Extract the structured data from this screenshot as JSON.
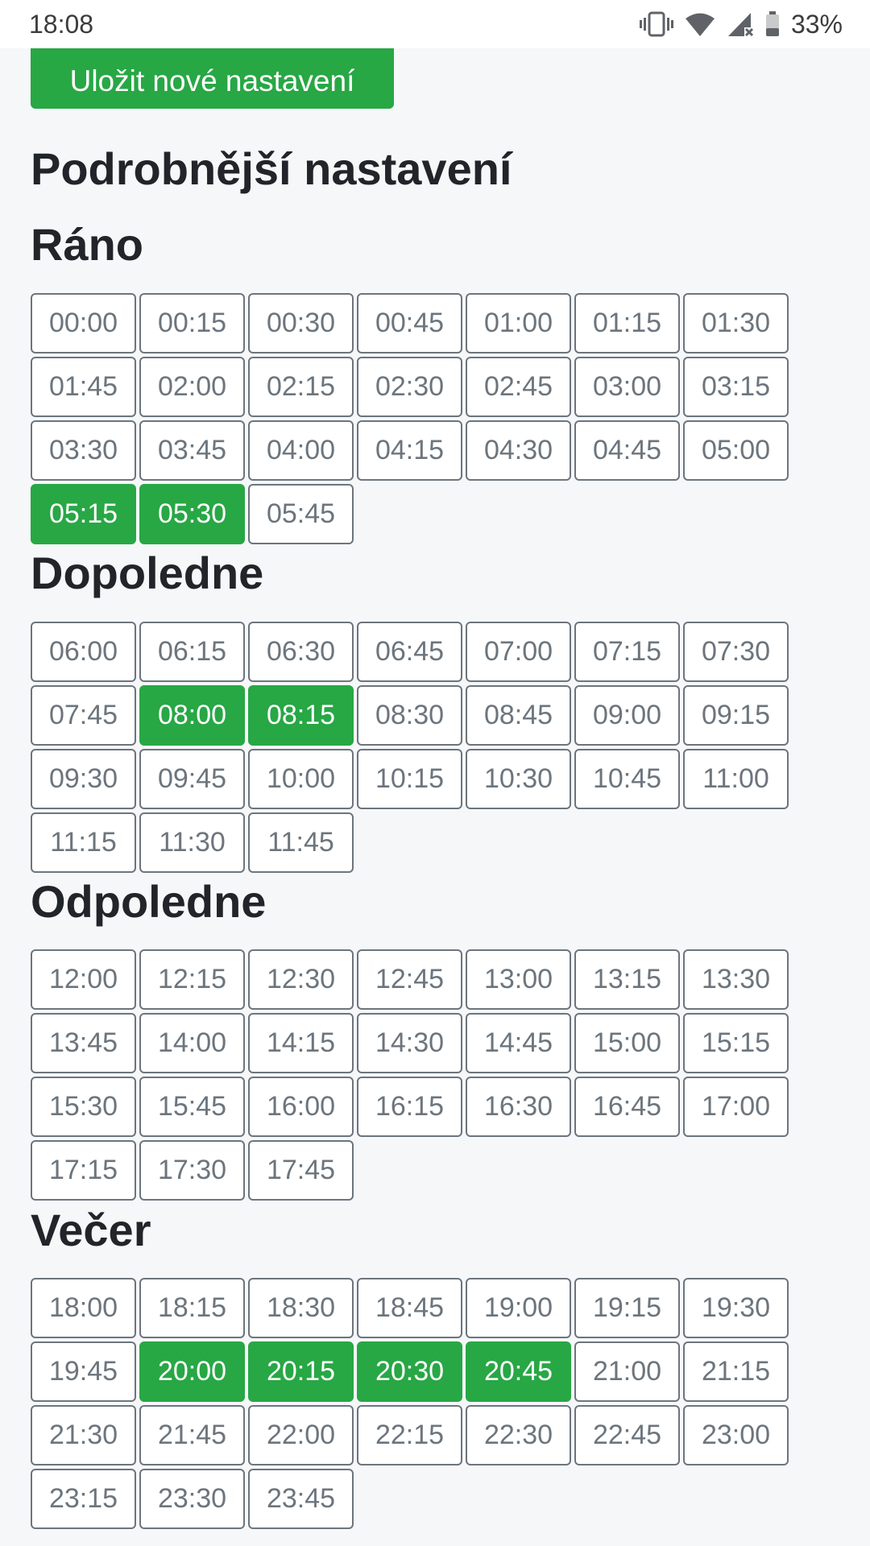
{
  "status_bar": {
    "time": "18:08",
    "battery": "33%",
    "icons": [
      "vibrate-icon",
      "wifi-icon",
      "signal-no-service-icon",
      "battery-icon"
    ]
  },
  "colors": {
    "accent": "#28a745",
    "slot_border": "#6c757d",
    "background": "#f6f7f9"
  },
  "save_button": {
    "label": "Uložit nové nastavení"
  },
  "page_title": "Podrobnější nastavení",
  "sections": [
    {
      "title": "Ráno",
      "slots": [
        {
          "time": "00:00",
          "selected": false
        },
        {
          "time": "00:15",
          "selected": false
        },
        {
          "time": "00:30",
          "selected": false
        },
        {
          "time": "00:45",
          "selected": false
        },
        {
          "time": "01:00",
          "selected": false
        },
        {
          "time": "01:15",
          "selected": false
        },
        {
          "time": "01:30",
          "selected": false
        },
        {
          "time": "01:45",
          "selected": false
        },
        {
          "time": "02:00",
          "selected": false
        },
        {
          "time": "02:15",
          "selected": false
        },
        {
          "time": "02:30",
          "selected": false
        },
        {
          "time": "02:45",
          "selected": false
        },
        {
          "time": "03:00",
          "selected": false
        },
        {
          "time": "03:15",
          "selected": false
        },
        {
          "time": "03:30",
          "selected": false
        },
        {
          "time": "03:45",
          "selected": false
        },
        {
          "time": "04:00",
          "selected": false
        },
        {
          "time": "04:15",
          "selected": false
        },
        {
          "time": "04:30",
          "selected": false
        },
        {
          "time": "04:45",
          "selected": false
        },
        {
          "time": "05:00",
          "selected": false
        },
        {
          "time": "05:15",
          "selected": true
        },
        {
          "time": "05:30",
          "selected": true
        },
        {
          "time": "05:45",
          "selected": false
        }
      ]
    },
    {
      "title": "Dopoledne",
      "slots": [
        {
          "time": "06:00",
          "selected": false
        },
        {
          "time": "06:15",
          "selected": false
        },
        {
          "time": "06:30",
          "selected": false
        },
        {
          "time": "06:45",
          "selected": false
        },
        {
          "time": "07:00",
          "selected": false
        },
        {
          "time": "07:15",
          "selected": false
        },
        {
          "time": "07:30",
          "selected": false
        },
        {
          "time": "07:45",
          "selected": false
        },
        {
          "time": "08:00",
          "selected": true
        },
        {
          "time": "08:15",
          "selected": true
        },
        {
          "time": "08:30",
          "selected": false
        },
        {
          "time": "08:45",
          "selected": false
        },
        {
          "time": "09:00",
          "selected": false
        },
        {
          "time": "09:15",
          "selected": false
        },
        {
          "time": "09:30",
          "selected": false
        },
        {
          "time": "09:45",
          "selected": false
        },
        {
          "time": "10:00",
          "selected": false
        },
        {
          "time": "10:15",
          "selected": false
        },
        {
          "time": "10:30",
          "selected": false
        },
        {
          "time": "10:45",
          "selected": false
        },
        {
          "time": "11:00",
          "selected": false
        },
        {
          "time": "11:15",
          "selected": false
        },
        {
          "time": "11:30",
          "selected": false
        },
        {
          "time": "11:45",
          "selected": false
        }
      ]
    },
    {
      "title": "Odpoledne",
      "slots": [
        {
          "time": "12:00",
          "selected": false
        },
        {
          "time": "12:15",
          "selected": false
        },
        {
          "time": "12:30",
          "selected": false
        },
        {
          "time": "12:45",
          "selected": false
        },
        {
          "time": "13:00",
          "selected": false
        },
        {
          "time": "13:15",
          "selected": false
        },
        {
          "time": "13:30",
          "selected": false
        },
        {
          "time": "13:45",
          "selected": false
        },
        {
          "time": "14:00",
          "selected": false
        },
        {
          "time": "14:15",
          "selected": false
        },
        {
          "time": "14:30",
          "selected": false
        },
        {
          "time": "14:45",
          "selected": false
        },
        {
          "time": "15:00",
          "selected": false
        },
        {
          "time": "15:15",
          "selected": false
        },
        {
          "time": "15:30",
          "selected": false
        },
        {
          "time": "15:45",
          "selected": false
        },
        {
          "time": "16:00",
          "selected": false
        },
        {
          "time": "16:15",
          "selected": false
        },
        {
          "time": "16:30",
          "selected": false
        },
        {
          "time": "16:45",
          "selected": false
        },
        {
          "time": "17:00",
          "selected": false
        },
        {
          "time": "17:15",
          "selected": false
        },
        {
          "time": "17:30",
          "selected": false
        },
        {
          "time": "17:45",
          "selected": false
        }
      ]
    },
    {
      "title": "Večer",
      "slots": [
        {
          "time": "18:00",
          "selected": false
        },
        {
          "time": "18:15",
          "selected": false
        },
        {
          "time": "18:30",
          "selected": false
        },
        {
          "time": "18:45",
          "selected": false
        },
        {
          "time": "19:00",
          "selected": false
        },
        {
          "time": "19:15",
          "selected": false
        },
        {
          "time": "19:30",
          "selected": false
        },
        {
          "time": "19:45",
          "selected": false
        },
        {
          "time": "20:00",
          "selected": true
        },
        {
          "time": "20:15",
          "selected": true
        },
        {
          "time": "20:30",
          "selected": true
        },
        {
          "time": "20:45",
          "selected": true
        },
        {
          "time": "21:00",
          "selected": false
        },
        {
          "time": "21:15",
          "selected": false
        },
        {
          "time": "21:30",
          "selected": false
        },
        {
          "time": "21:45",
          "selected": false
        },
        {
          "time": "22:00",
          "selected": false
        },
        {
          "time": "22:15",
          "selected": false
        },
        {
          "time": "22:30",
          "selected": false
        },
        {
          "time": "22:45",
          "selected": false
        },
        {
          "time": "23:00",
          "selected": false
        },
        {
          "time": "23:15",
          "selected": false
        },
        {
          "time": "23:30",
          "selected": false
        },
        {
          "time": "23:45",
          "selected": false
        }
      ]
    }
  ]
}
